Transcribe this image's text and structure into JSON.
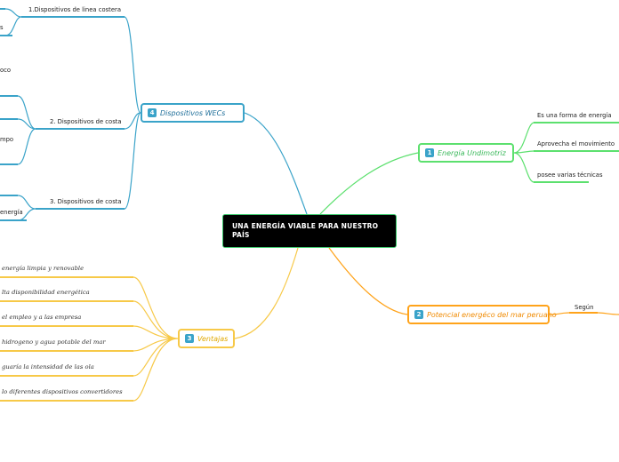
{
  "central": {
    "title": "UNA ENERGÍA VIABLE PARA NUESTRO PAÍS"
  },
  "colors": {
    "green": "#5ce06e",
    "orange": "#ffa31a",
    "blue": "#3aa3c9",
    "yellow": "#f7c948",
    "central_bg": "#000000"
  },
  "branches": {
    "energia": {
      "badge": "1",
      "label": "Energía Undimotriz",
      "children": [
        "Es una forma de energía",
        "Aprovecha el movimiento",
        "posee varias técnicas"
      ]
    },
    "potencial": {
      "badge": "2",
      "label": "Potencial energéco del mar peruano",
      "children": [
        "Según"
      ]
    },
    "ventajas": {
      "badge": "3",
      "label": "Ventajas",
      "children": [
        "energía limpia y renovable",
        "lta disponibilidad energética",
        "el empleo y a las empresa",
        "hidrogeno y agua potable del mar",
        "guaría la intensidad de las ola",
        "lo diferentes dispositivos convertidores"
      ]
    },
    "dispositivos": {
      "badge": "4",
      "label": "Dispositivos WECs",
      "children": [
        {
          "label": "1.Dispositivos de linea costera",
          "leaves": [
            "s"
          ]
        },
        {
          "label": "2. Dispositivos de costa",
          "leaves": [
            "oco",
            "mpo"
          ]
        },
        {
          "label": "3. Dispositivos de costa",
          "leaves": [
            "energía"
          ]
        }
      ]
    }
  }
}
